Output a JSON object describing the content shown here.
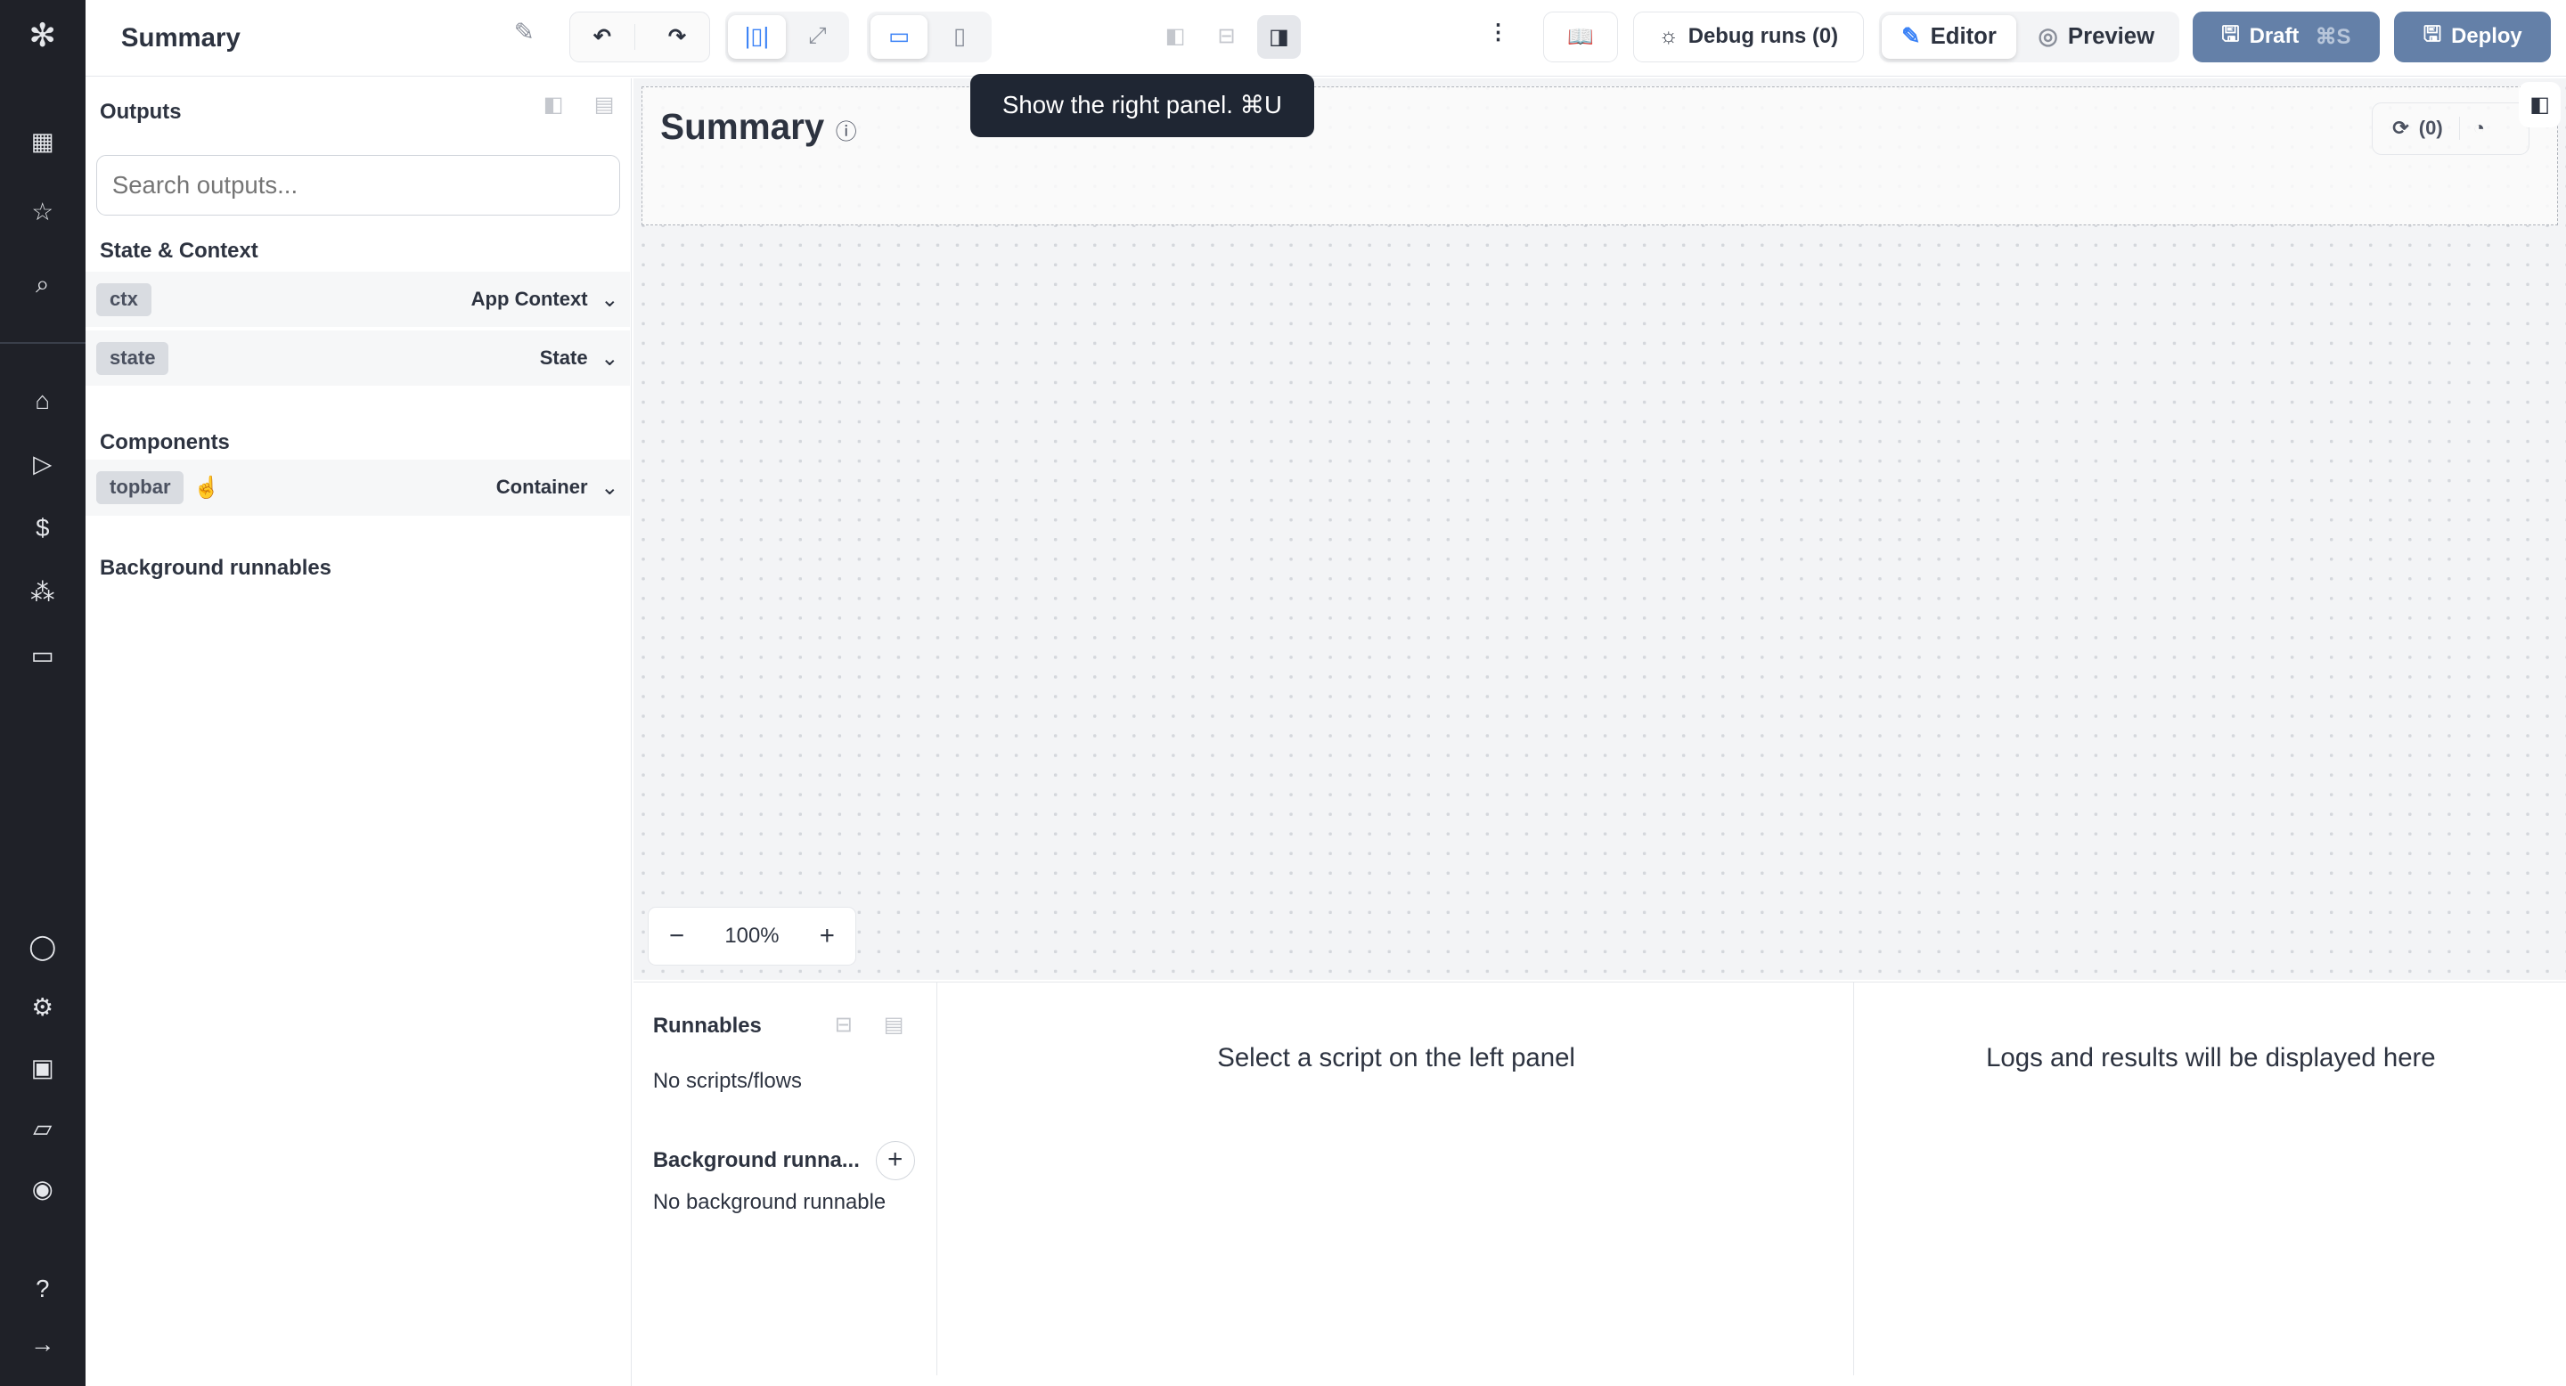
{
  "header": {
    "title": "Summary",
    "debug_runs": "Debug runs (0)",
    "editor": "Editor",
    "preview": "Preview",
    "draft": "Draft",
    "draft_shortcut": "⌘S",
    "deploy": "Deploy"
  },
  "tooltip": "Show the right panel. ⌘U",
  "left": {
    "title": "Outputs",
    "search_placeholder": "Search outputs...",
    "state_section": "State & Context",
    "state_items": [
      {
        "tag": "ctx",
        "label": "App Context"
      },
      {
        "tag": "state",
        "label": "State"
      }
    ],
    "components_section": "Components",
    "components": [
      {
        "tag": "topbar",
        "label": "Container"
      }
    ],
    "background_section": "Background runnables"
  },
  "canvas": {
    "title": "Summary",
    "refresh_count": "(0)",
    "zoom": "100%"
  },
  "bottom": {
    "runnables_title": "Runnables",
    "no_scripts": "No scripts/flows",
    "background_title": "Background runna...",
    "no_background": "No background runnable",
    "select_script": "Select a script on the left panel",
    "logs": "Logs and results will be displayed here"
  },
  "colors": {
    "nav_bg": "#1f2128",
    "deploy": "#6480a8",
    "accent": "#3b82f6"
  }
}
